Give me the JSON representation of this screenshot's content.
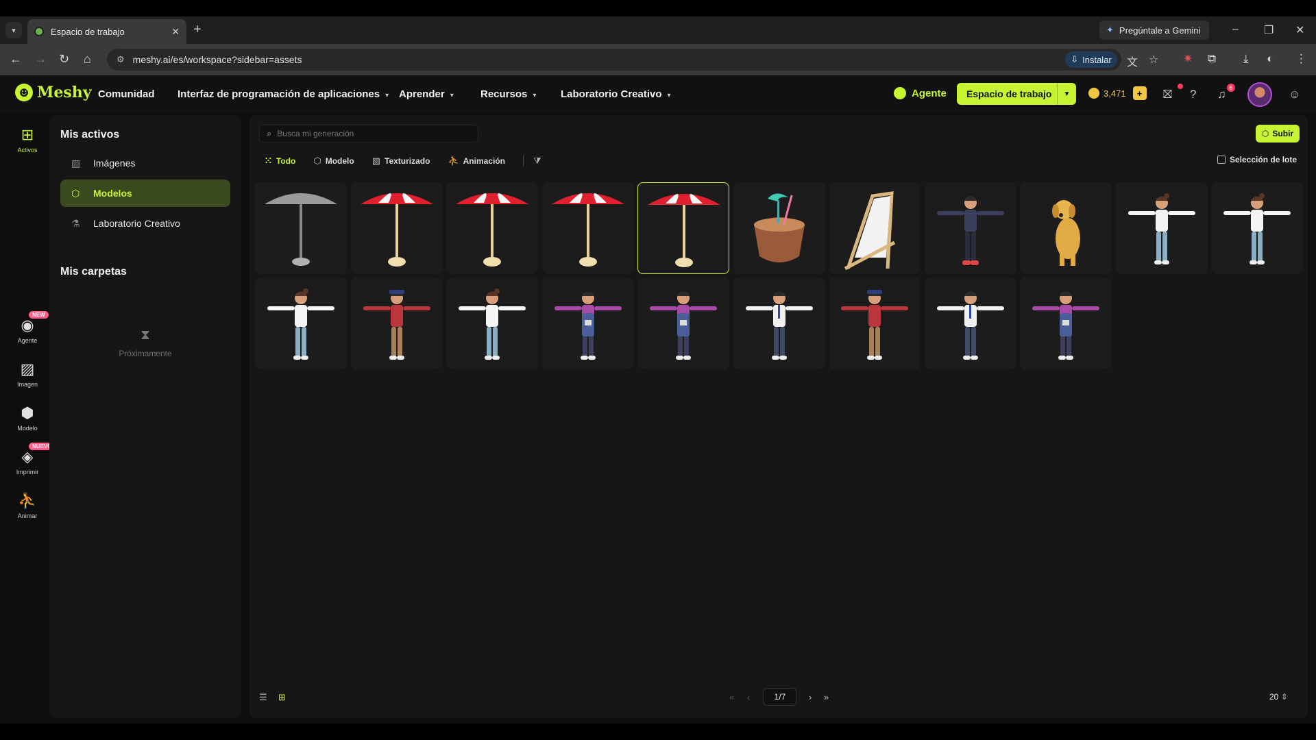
{
  "browser": {
    "tab_title": "Espacio de trabajo",
    "tab_close": "✕",
    "new_tab": "+",
    "gemini_label": "Pregúntale a Gemini",
    "url": "meshy.ai/es/workspace?sidebar=assets",
    "install_label": "Instalar"
  },
  "app": {
    "logo": "Meshy",
    "nav": [
      {
        "label": "Comunidad",
        "caret": ""
      },
      {
        "label": "Interfaz de programación de aplicaciones",
        "caret": "▾"
      },
      {
        "label": "Aprender",
        "caret": "▾"
      },
      {
        "label": "Recursos",
        "caret": "▾"
      },
      {
        "label": "Laboratorio Creativo",
        "caret": "▾"
      }
    ],
    "agent_label": "Agente",
    "workspace_label": "Espacio de trabajo",
    "credits": "3,471",
    "bell_count": "6"
  },
  "rail": {
    "items": [
      {
        "label": "Activos",
        "icon": "grid-icon"
      },
      {
        "label": "Agente",
        "icon": "agent-icon",
        "badge": "NEW"
      },
      {
        "label": "Imagen",
        "icon": "image-icon"
      },
      {
        "label": "Modelo",
        "icon": "model-icon"
      },
      {
        "label": "Imprimir",
        "icon": "print-icon",
        "badge": "NUEVO"
      },
      {
        "label": "Animar",
        "icon": "run-icon"
      }
    ]
  },
  "sidebar": {
    "assets_title": "Mis activos",
    "items": [
      {
        "label": "Imágenes"
      },
      {
        "label": "Modelos"
      },
      {
        "label": "Laboratorio Creativo"
      }
    ],
    "folders_title": "Mis carpetas",
    "coming_soon": "Próximamente"
  },
  "main": {
    "search_placeholder": "Busca mi generación",
    "upload_label": "Subir",
    "filters": [
      {
        "label": "Todo"
      },
      {
        "label": "Modelo"
      },
      {
        "label": "Texturizado"
      },
      {
        "label": "Animación"
      }
    ],
    "batch_label": "Selección de lote",
    "assets": [
      {
        "kind": "umbrella-gray"
      },
      {
        "kind": "umbrella-red"
      },
      {
        "kind": "umbrella-red"
      },
      {
        "kind": "umbrella-red"
      },
      {
        "kind": "umbrella-red",
        "selected": true
      },
      {
        "kind": "coconut"
      },
      {
        "kind": "beach-chair"
      },
      {
        "kind": "man-hoodie"
      },
      {
        "kind": "dog"
      },
      {
        "kind": "woman-white"
      },
      {
        "kind": "woman-white"
      },
      {
        "kind": "woman-white"
      },
      {
        "kind": "man-plaid"
      },
      {
        "kind": "woman-white"
      },
      {
        "kind": "woman-apron"
      },
      {
        "kind": "woman-apron"
      },
      {
        "kind": "man-tie"
      },
      {
        "kind": "man-plaid"
      },
      {
        "kind": "man-tie"
      },
      {
        "kind": "woman-apron"
      }
    ],
    "page": "1/7",
    "per_page": "20"
  },
  "colors": {
    "accent": "#c6f432",
    "umbrella_red": "#e0202e",
    "badge_pink": "#ff5c8a"
  }
}
